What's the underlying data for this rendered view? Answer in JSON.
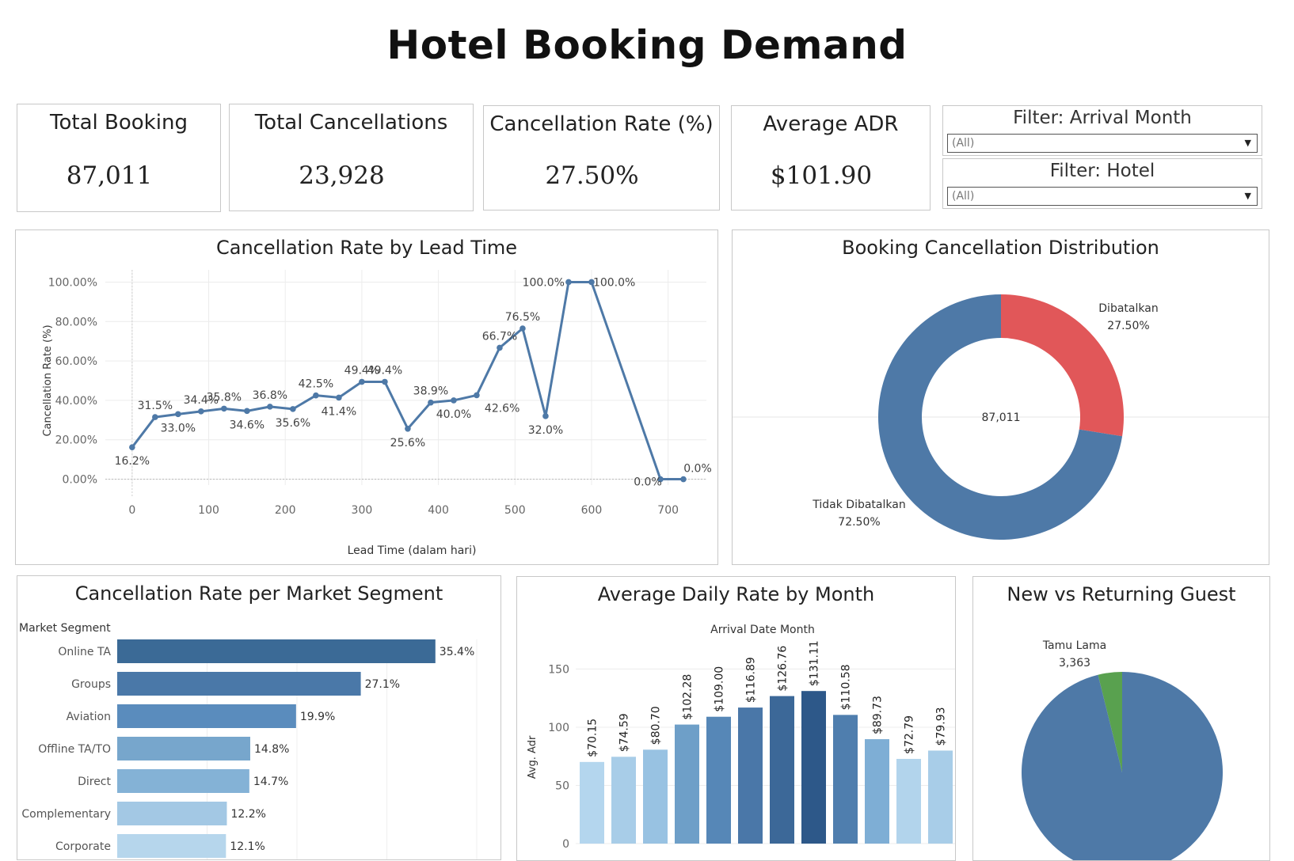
{
  "title": "Hotel Booking Demand",
  "kpis": [
    {
      "label": "Total Booking",
      "value": "87,011"
    },
    {
      "label": "Total Cancellations",
      "value": "23,928"
    },
    {
      "label": "Cancellation Rate (%)",
      "value": "27.50%"
    },
    {
      "label": "Average ADR",
      "value": "$101.90"
    }
  ],
  "filters": [
    {
      "label": "Filter: Arrival Month",
      "value": "(All)"
    },
    {
      "label": "Filter: Hotel",
      "value": "(All)"
    }
  ],
  "colors": {
    "primary": "#4e79a7",
    "cancel": "#e15759",
    "green": "#59a14f"
  },
  "chart_data": [
    {
      "type": "line",
      "title": "Cancellation Rate by Lead Time",
      "xlabel": "Lead Time (dalam hari)",
      "ylabel": "Cancellation Rate (%)",
      "xlim": [
        -35,
        750
      ],
      "ylim": [
        -3,
        103
      ],
      "x_ticks": [
        "0",
        "100",
        "200",
        "300",
        "400",
        "500",
        "600",
        "700"
      ],
      "y_ticks": [
        "0.00%",
        "20.00%",
        "40.00%",
        "60.00%",
        "80.00%",
        "100.00%"
      ],
      "x": [
        0,
        30,
        60,
        90,
        120,
        150,
        180,
        210,
        240,
        270,
        300,
        330,
        360,
        390,
        420,
        450,
        480,
        510,
        540,
        570,
        600,
        690,
        720
      ],
      "values": [
        16.2,
        31.5,
        33.0,
        34.4,
        35.8,
        34.6,
        36.8,
        35.6,
        42.5,
        41.4,
        49.4,
        49.4,
        25.6,
        38.9,
        40.0,
        42.6,
        66.7,
        76.5,
        32.0,
        100.0,
        100.0,
        0.0,
        0.0
      ],
      "labels": [
        "16.2%",
        "31.5%",
        "33.0%",
        "34.4%",
        "35.8%",
        "34.6%",
        "36.8%",
        "35.6%",
        "42.5%",
        "41.4%",
        "49.4%",
        "49.4%",
        "25.6%",
        "38.9%",
        "40.0%",
        "42.6%",
        "66.7%",
        "76.5%",
        "32.0%",
        "100.0%",
        "100.0%",
        "0.0%",
        "0.0%"
      ]
    },
    {
      "type": "pie",
      "title": "Booking Cancellation Distribution",
      "center_label": "87,011",
      "slices": [
        {
          "name": "Dibatalkan",
          "value": 27.5,
          "label": "27.50%",
          "color": "#e15759"
        },
        {
          "name": "Tidak Dibatalkan",
          "value": 72.5,
          "label": "72.50%",
          "color": "#4e79a7"
        }
      ]
    },
    {
      "type": "bar",
      "title": "Cancellation Rate per Market Segment",
      "category_header": "Market Segment",
      "categories": [
        "Online TA",
        "Groups",
        "Aviation",
        "Offline TA/TO",
        "Direct",
        "Complementary",
        "Corporate"
      ],
      "values": [
        35.4,
        27.1,
        19.9,
        14.8,
        14.7,
        12.2,
        12.1
      ],
      "labels": [
        "35.4%",
        "27.1%",
        "19.9%",
        "14.8%",
        "14.7%",
        "12.2%",
        "12.1%"
      ],
      "colors": [
        "#3b6a96",
        "#4a78a8",
        "#5a8cbd",
        "#77a6cc",
        "#84b2d6",
        "#a3c8e4",
        "#b6d6ec"
      ],
      "xlim": [
        0,
        40
      ]
    },
    {
      "type": "bar",
      "title": "Average Daily Rate by Month",
      "xlabel": "Arrival Date Month",
      "ylabel": "Avg. Adr",
      "ylim": [
        0,
        170
      ],
      "y_ticks": [
        0,
        50,
        100,
        150
      ],
      "values": [
        70.15,
        74.59,
        80.7,
        102.28,
        109.0,
        116.89,
        126.76,
        131.11,
        110.58,
        89.73,
        72.79,
        79.93
      ],
      "labels": [
        "$70.15",
        "$74.59",
        "$80.70",
        "$102.28",
        "$109.00",
        "$116.89",
        "$126.76",
        "$131.11",
        "$110.58",
        "$89.73",
        "$72.79",
        "$79.93"
      ],
      "colors": [
        "#b4d6ee",
        "#a8cde8",
        "#98c2e2",
        "#6e9fc8",
        "#5687b7",
        "#4a77a8",
        "#3c6898",
        "#2d5889",
        "#4f7eae",
        "#7eaed5",
        "#b2d4ec",
        "#a8cde8"
      ]
    },
    {
      "type": "pie",
      "title": "New vs Returning Guest",
      "slices": [
        {
          "name": "Tamu Lama",
          "value": 3363,
          "label": "3,363",
          "color": "#59a14f"
        },
        {
          "name": "",
          "value": 83648,
          "label": "",
          "color": "#4e79a7"
        }
      ]
    }
  ]
}
